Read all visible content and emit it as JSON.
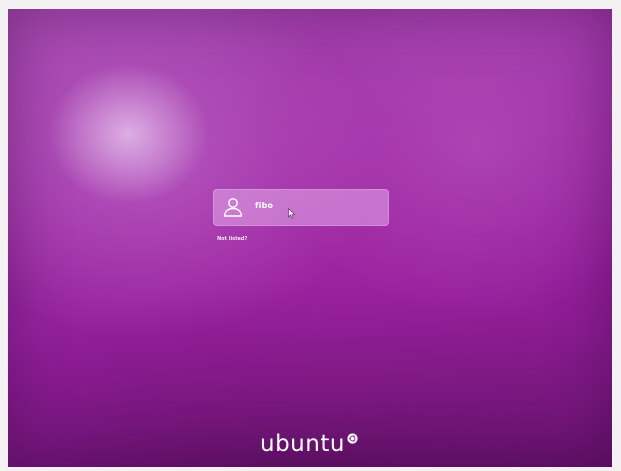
{
  "login": {
    "username": "fibo",
    "not_listed_label": "Not listed?"
  },
  "branding": {
    "wordmark": "ubuntu",
    "logo_name": "circle-of-friends-icon"
  },
  "icons": {
    "avatar": "user-avatar-icon",
    "cursor": "mouse-pointer-icon"
  },
  "colors": {
    "background_primary": "#9c2fa6",
    "background_dark": "#6e1575",
    "card_background": "#d89ae0",
    "text": "#ffffff"
  }
}
